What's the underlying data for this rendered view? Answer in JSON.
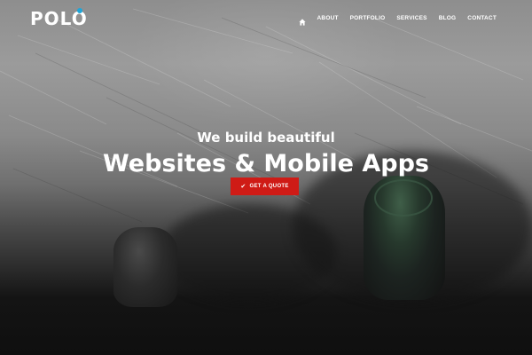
{
  "brand": {
    "logo_text": "POLO",
    "logo_dot_color": "#1fa6d9"
  },
  "nav": {
    "home_icon": "home-icon",
    "items": [
      "ABOUT",
      "PORTFOLIO",
      "SERVICES",
      "BLOG",
      "CONTACT"
    ]
  },
  "hero": {
    "subtitle": "We build beautiful",
    "title": "Websites & Mobile Apps",
    "cta_label": "GET A QUOTE",
    "cta_icon": "check-icon",
    "cta_color": "#cf1b16"
  }
}
